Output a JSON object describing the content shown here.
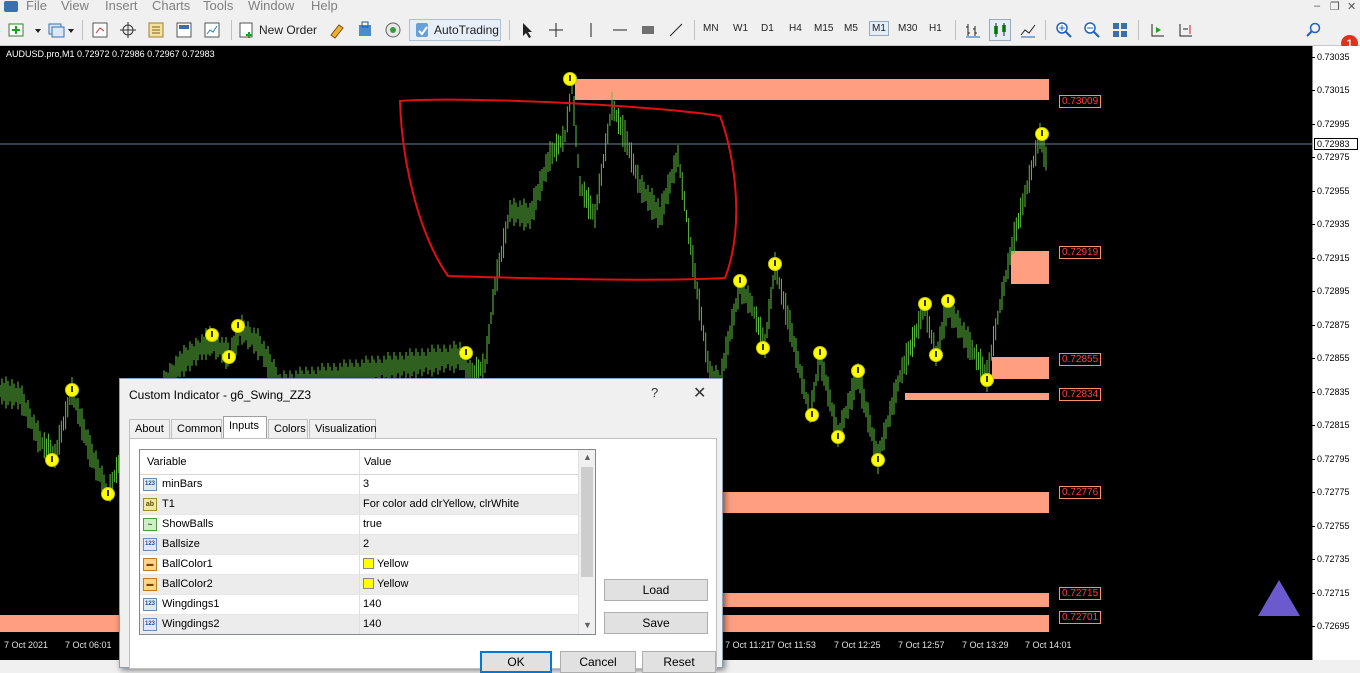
{
  "menu": [
    "File",
    "View",
    "Insert",
    "Charts",
    "Tools",
    "Window",
    "Help"
  ],
  "toolbar": {
    "new_order": "New Order",
    "autotrading": "AutoTrading",
    "timeframes": [
      "MN",
      "W1",
      "D1",
      "H4",
      "M15",
      "M5",
      "M1",
      "M30",
      "H1"
    ],
    "active_timeframe": "M1",
    "notifications": "1"
  },
  "chart": {
    "symbol_info": "AUDUSD.pro,M1  0.72972 0.72986 0.72967 0.72983",
    "current_price": "0.72983",
    "price_ticks": [
      "0.73035",
      "0.73015",
      "0.72995",
      "0.72975",
      "0.72955",
      "0.72935",
      "0.72915",
      "0.72895",
      "0.72875",
      "0.72855",
      "0.72835",
      "0.72815",
      "0.72795",
      "0.72775",
      "0.72755",
      "0.72735",
      "0.72715",
      "0.72695"
    ],
    "time_ticks": [
      "7 Oct 2021",
      "7 Oct 06:01",
      "7 Oct 11:21",
      "7 Oct 11:53",
      "7 Oct 12:25",
      "7 Oct 12:57",
      "7 Oct 13:29",
      "7 Oct 14:01"
    ],
    "levels": [
      "0.73009",
      "0.72919",
      "0.72855",
      "0.72834",
      "0.72776",
      "0.72715",
      "0.72701"
    ],
    "colors": {
      "candles": "#5fbf3f",
      "zones": "#ff9f7f",
      "balls": "#ffff00",
      "annotation": "#e01010"
    }
  },
  "dialog": {
    "title": "Custom Indicator - g6_Swing_ZZ3",
    "help": "?",
    "close": "✕",
    "tabs": [
      "About",
      "Common",
      "Inputs",
      "Colors",
      "Visualization"
    ],
    "active_tab": "Inputs",
    "columns": [
      "Variable",
      "Value"
    ],
    "rows": [
      {
        "icon": "123",
        "name": "minBars",
        "value": "3"
      },
      {
        "icon": "ab",
        "name": "T1",
        "value": "For color add clrYellow, clrWhite"
      },
      {
        "icon": "bool",
        "name": "ShowBalls",
        "value": "true"
      },
      {
        "icon": "123",
        "name": "Ballsize",
        "value": "2"
      },
      {
        "icon": "color",
        "name": "BallColor1",
        "value": "Yellow"
      },
      {
        "icon": "color",
        "name": "BallColor2",
        "value": "Yellow"
      },
      {
        "icon": "123",
        "name": "Wingdings1",
        "value": "140"
      },
      {
        "icon": "123",
        "name": "Wingdings2",
        "value": "140"
      }
    ],
    "buttons": {
      "load": "Load",
      "save": "Save",
      "ok": "OK",
      "cancel": "Cancel",
      "reset": "Reset"
    }
  }
}
